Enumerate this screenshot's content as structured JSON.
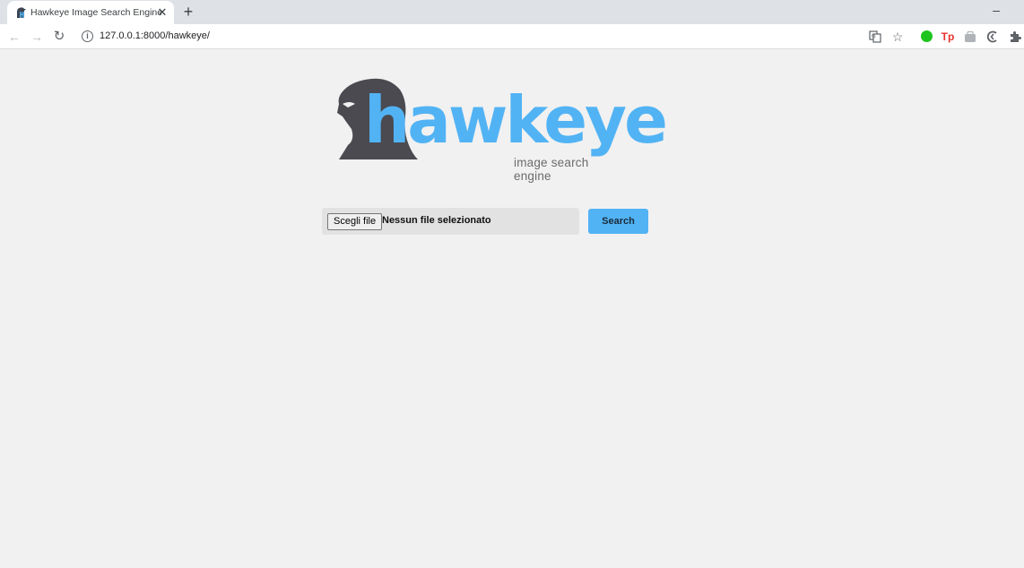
{
  "browser": {
    "tab": {
      "title": "Hawkeye Image Search Engine",
      "favicon": "hawk-favicon-icon",
      "close_icon": "close-icon"
    },
    "new_tab_icon": "plus-icon",
    "minimize_icon": "minimize-icon",
    "toolbar": {
      "back_icon": "arrow-left-icon",
      "forward_icon": "arrow-right-icon",
      "reload_icon": "reload-icon",
      "info_icon": "info-icon",
      "url": "127.0.0.1:8000/hawkeye/",
      "extensions": [
        "translate-icon",
        "star-icon",
        "green-extension-icon",
        "tp-extension-icon",
        "bag-extension-icon",
        "c-extension-icon",
        "puzzle-icon"
      ]
    }
  },
  "page": {
    "logo": {
      "wordmark": "hawkeye",
      "tagline": "image search engine",
      "brand_color": "#52b3f4",
      "silhouette_color": "#4a4a50"
    },
    "upload": {
      "choose_file_label": "Scegli file",
      "no_file_text": "Nessun file selezionato"
    },
    "search_button_label": "Search"
  },
  "colors": {
    "accent": "#52b3f4",
    "page_background": "#f1f1f1",
    "tabstrip_background": "#dee1e6"
  }
}
